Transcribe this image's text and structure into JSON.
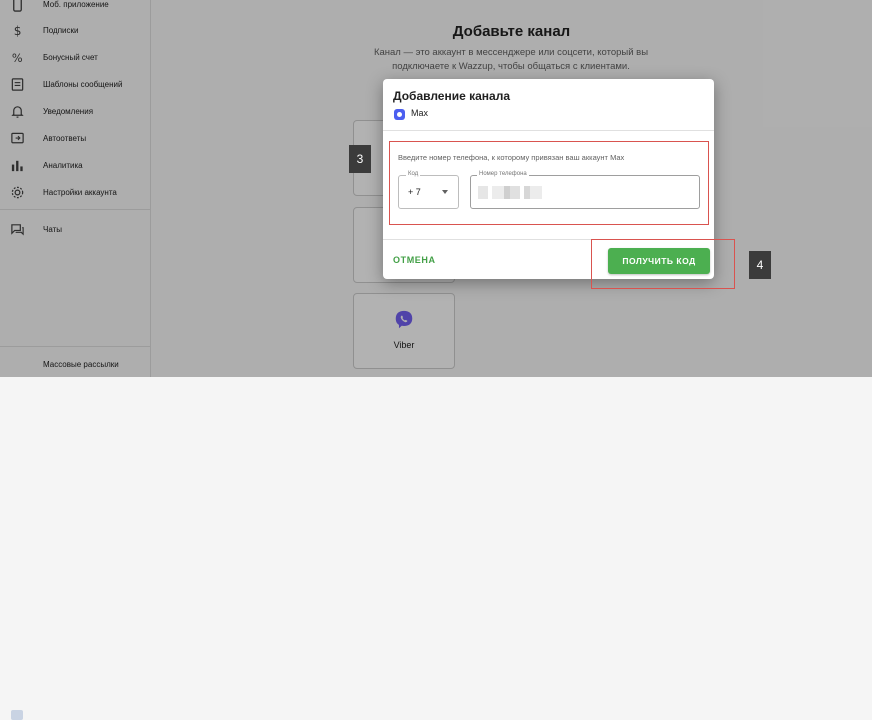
{
  "sidebar": {
    "items": [
      {
        "label": "Моб. приложение",
        "icon": "phone-icon"
      },
      {
        "label": "Подписки",
        "icon": "dollar-icon"
      },
      {
        "label": "Бонусный счет",
        "icon": "percent-icon"
      },
      {
        "label": "Шаблоны сообщений",
        "icon": "template-icon"
      },
      {
        "label": "Уведомления",
        "icon": "bell-icon"
      },
      {
        "label": "Автоответы",
        "icon": "autoreply-icon"
      },
      {
        "label": "Аналитика",
        "icon": "analytics-icon"
      },
      {
        "label": "Настройки аккаунта",
        "icon": "gear-icon"
      },
      {
        "label": "Чаты",
        "icon": "chat-icon"
      }
    ],
    "bulk_label": "Массовые рассылки"
  },
  "main": {
    "title": "Добавьте канал",
    "description": "Канал — это аккаунт в мессенджере или соцсети, который вы подключаете к Wazzup, чтобы общаться с клиентами.",
    "viber_label": "Viber"
  },
  "dialog": {
    "title": "Добавление канала",
    "channel_name": "Max",
    "hint": "Введите номер телефона, к которому привязан ваш аккаунт Max",
    "code_legend": "Код",
    "code_value": "+ 7",
    "phone_legend": "Номер телефона",
    "cancel_label": "ОТМЕНА",
    "get_code_label": "ПОЛУЧИТЬ КОД"
  },
  "annotations": {
    "step_3": "3",
    "step_4": "4"
  },
  "colors": {
    "accent_green": "#4caf50",
    "annotation_red": "#d9534f",
    "viber_purple": "#7360f2"
  }
}
